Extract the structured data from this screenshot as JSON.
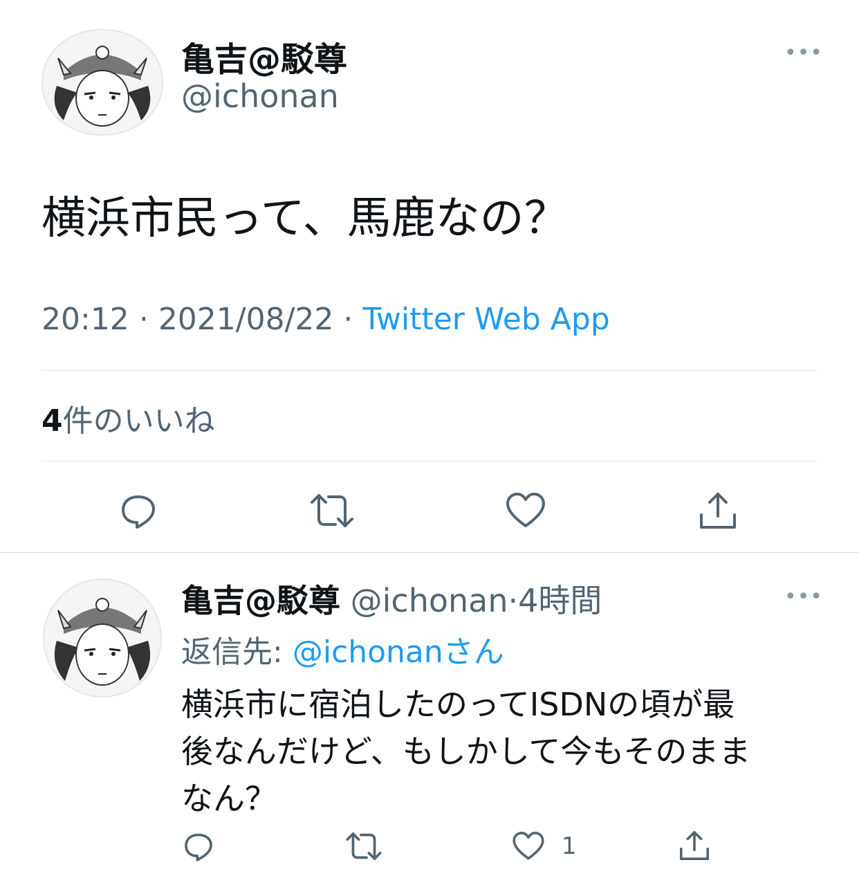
{
  "main_tweet": {
    "display_name": "亀吉@駁尊",
    "handle": "@ichonan",
    "more_label": "•••",
    "text": "横浜市民って、馬鹿なの？",
    "time": "20:12",
    "date": "2021/08/22",
    "separator": "·",
    "source": "Twitter Web App",
    "likes_count": "4",
    "likes_label": "件のいいね"
  },
  "reply_tweet": {
    "display_name": "亀吉@駁尊",
    "handle": "@ichonan",
    "separator": "·",
    "time_ago": "4時間",
    "more_label": "•••",
    "replying_to_label": "返信先: ",
    "replying_to_handle": "@ichonanさん",
    "text_lines": [
      "横浜市に宿泊したのってISDNの頃が最",
      "後なんだけど、もしかして今もそのまま",
      "なん？"
    ],
    "like_count": "1"
  },
  "icons": {
    "reply": "reply-icon",
    "retweet": "retweet-icon",
    "like": "heart-icon",
    "share": "share-icon",
    "more": "more-icon"
  },
  "colors": {
    "link": "#1d9bf0",
    "secondary_text": "#536471",
    "primary_text": "#0f1419"
  }
}
